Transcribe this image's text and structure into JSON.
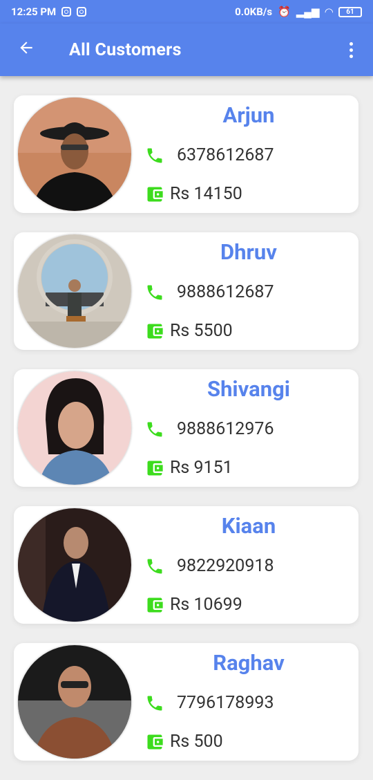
{
  "status_bar": {
    "time": "12:25 PM",
    "net_speed": "0.0KB/s",
    "battery": "61"
  },
  "app_bar": {
    "title": "All Customers",
    "back_icon": "arrow-left-icon",
    "menu_icon": "more-vert-icon"
  },
  "colors": {
    "accent": "#5783ec",
    "icon_green": "#3ddc1e"
  },
  "customers": [
    {
      "name": "Arjun",
      "phone": "6378612687",
      "balance": "Rs 14150"
    },
    {
      "name": "Dhruv",
      "phone": "9888612687",
      "balance": "Rs 5500"
    },
    {
      "name": "Shivangi",
      "phone": "9888612976",
      "balance": "Rs 9151"
    },
    {
      "name": "Kiaan",
      "phone": "9822920918",
      "balance": "Rs 10699"
    },
    {
      "name": "Raghav",
      "phone": "7796178993",
      "balance": "Rs 500"
    }
  ]
}
